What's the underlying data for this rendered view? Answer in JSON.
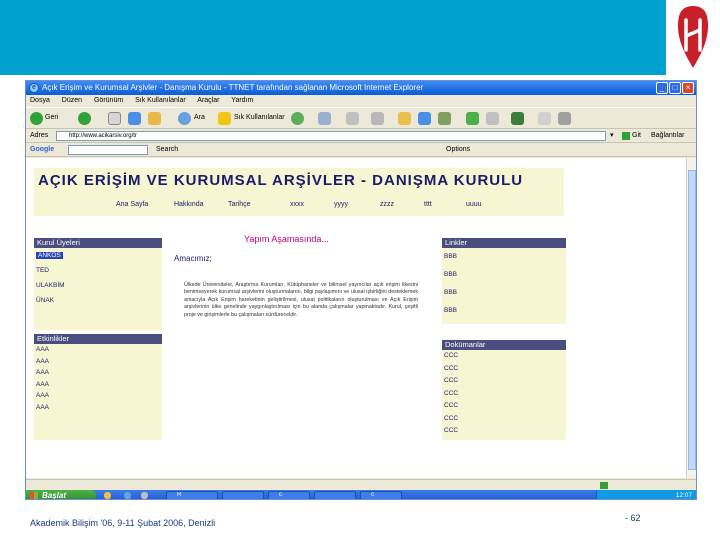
{
  "window": {
    "title": "Açık Erişim ve Kurumsal Arşivler - Danışma Kurulu - TTNET tarafından sağlanan Microsoft Internet Explorer",
    "menu": [
      "Dosya",
      "Düzen",
      "Görünüm",
      "Sık Kullanılanlar",
      "Araçlar",
      "Yardım"
    ],
    "toolbar": {
      "back_label": "Geri",
      "search_label": "Ara",
      "favorites_label": "Sık Kullanılanlar"
    },
    "address_label": "Adres",
    "address_value": "http://www.acikarsiv.org/tr",
    "go_label": "Git",
    "links_label": "Bağlantılar",
    "google_toolbar": {
      "logo": "Google",
      "search_label": "Search",
      "options_label": "Options"
    }
  },
  "site": {
    "title": "AÇIK ERİŞİM VE KURUMSAL ARŞİVLER - DANIŞMA KURULU",
    "nav": [
      "Ana Sayfa",
      "Hakkında",
      "Tarihçe",
      "xxxx",
      "yyyy",
      "zzzz",
      "tttt",
      "uuuu"
    ],
    "left_panel": {
      "heading": "Kurul Üyeleri",
      "items": [
        "ANKOS",
        "TED",
        "ULAKBİM",
        "ÜNAK"
      ]
    },
    "events_panel": {
      "heading": "Etkinlikler",
      "items": [
        "AAA",
        "AAA",
        "AAA",
        "AAA",
        "AAA",
        "AAA"
      ]
    },
    "under_construction": "Yapım Aşamasında...",
    "purpose_title": "Amacımız;",
    "purpose_body": "Ülkede Üniversiteler, Araştırma Kurumları, Kütüphaneler ve bilimsel yayıncılar açık erişim ilkesini benimseyerek kurumsal arşivlerini oluşturmalarını, bilgi paylaşımını ve ulusal işbirliğini desteklemek amacıyla Açık Erişim hareketinin geliştirilmesi, ulusal politikaların oluşturulması ve Açık Erişim arşivlerinin ülke genelinde yaygınlaştırılması için bu alanda çalışmalar yapmaktadır. Kurul, çeşitli proje ve girişimlerle bu çalışmaları sürdürecektir.",
    "right_panel": {
      "heading": "Linkler",
      "items": [
        "BBB",
        "BBB",
        "BBB",
        "BBB"
      ]
    },
    "docs_panel": {
      "heading": "Dokümanlar",
      "items": [
        "CCC",
        "CCC",
        "CCC",
        "CCC",
        "CCC",
        "CCC",
        "CCC"
      ]
    }
  },
  "taskbar": {
    "start_label": "Başlat",
    "apps": [
      "R",
      "",
      "c",
      "",
      "c"
    ],
    "clock": "12:07"
  },
  "slide": {
    "footer": "Akademik Bilişim '06, 9-11 Şubat 2006, Denizli",
    "page_number": "- 62"
  }
}
